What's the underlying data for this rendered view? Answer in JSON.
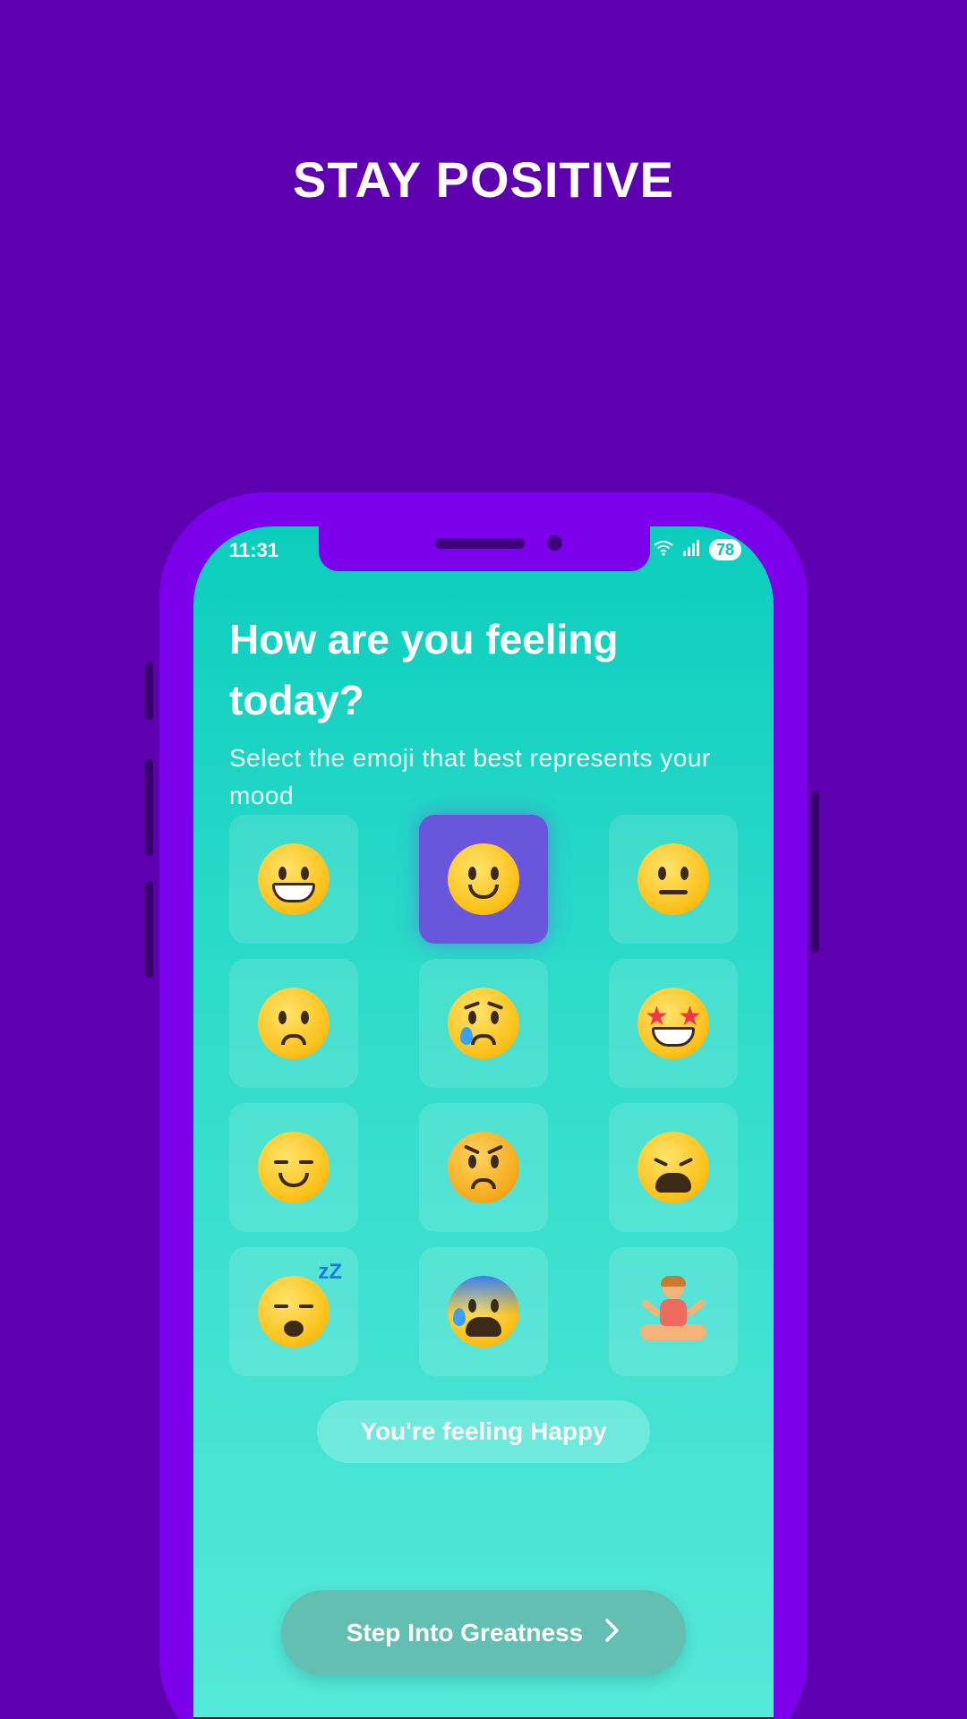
{
  "headline": "STAY POSITIVE",
  "status": {
    "time": "11:31",
    "wifi_icon": "wifi-icon",
    "signal_icon": "signal-icon",
    "battery": "78"
  },
  "mood": {
    "question": "How are you feeling today?",
    "subtitle": "Select the emoji that best represents your mood",
    "selected_index": 1,
    "options": [
      {
        "icon": "grinning-face-icon"
      },
      {
        "icon": "slightly-smiling-face-icon"
      },
      {
        "icon": "neutral-face-icon"
      },
      {
        "icon": "confused-face-icon"
      },
      {
        "icon": "crying-face-icon"
      },
      {
        "icon": "star-struck-face-icon"
      },
      {
        "icon": "relieved-face-icon"
      },
      {
        "icon": "angry-face-icon"
      },
      {
        "icon": "tired-face-icon"
      },
      {
        "icon": "sleeping-face-icon"
      },
      {
        "icon": "anxious-face-icon"
      },
      {
        "icon": "meditating-person-icon"
      }
    ],
    "feeling_label": "You're feeling Happy"
  },
  "cta": {
    "label": "Step Into Greatness",
    "icon": "chevron-right-icon"
  },
  "colors": {
    "background": "#5c00b0",
    "phone_frame": "#7d00ea",
    "screen_top": "#0ccdbd",
    "screen_bottom": "#56e8d9",
    "selected_tile": "#6a55dd",
    "cta_button": "#62bfb2"
  }
}
